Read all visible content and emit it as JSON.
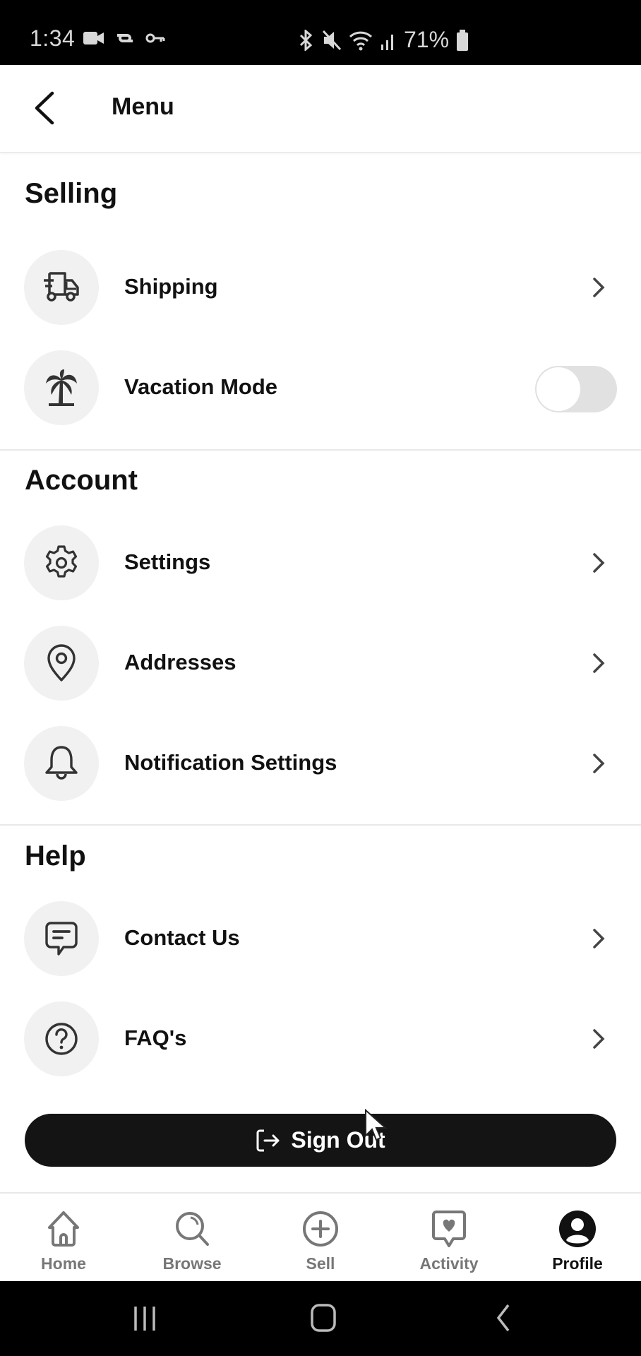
{
  "status_bar": {
    "time": "1:34",
    "left_icons": [
      "video-call-icon",
      "link-icon",
      "vpn-key-icon"
    ],
    "right_icons": [
      "bluetooth-icon",
      "mute-icon",
      "wifi-icon",
      "signal-icon"
    ],
    "battery": "71%"
  },
  "header": {
    "title": "Menu",
    "back_icon": "chevron-left-icon"
  },
  "sections": [
    {
      "title": "Selling",
      "items": [
        {
          "label": "Shipping",
          "icon": "truck-icon",
          "control": "chevron"
        },
        {
          "label": "Vacation Mode",
          "icon": "palm-tree-icon",
          "control": "toggle",
          "toggle_on": false
        }
      ]
    },
    {
      "title": "Account",
      "items": [
        {
          "label": "Settings",
          "icon": "gear-icon",
          "control": "chevron"
        },
        {
          "label": "Addresses",
          "icon": "location-pin-icon",
          "control": "chevron"
        },
        {
          "label": "Notification Settings",
          "icon": "bell-icon",
          "control": "chevron"
        }
      ]
    },
    {
      "title": "Help",
      "items": [
        {
          "label": "Contact Us",
          "icon": "chat-icon",
          "control": "chevron"
        },
        {
          "label": "FAQ's",
          "icon": "question-circle-icon",
          "control": "chevron"
        }
      ]
    }
  ],
  "sign_out": {
    "label": "Sign Out",
    "icon": "sign-out-icon"
  },
  "tabbar": {
    "tabs": [
      {
        "label": "Home",
        "icon": "home-icon",
        "active": false
      },
      {
        "label": "Browse",
        "icon": "search-icon",
        "active": false
      },
      {
        "label": "Sell",
        "icon": "plus-circle-icon",
        "active": false
      },
      {
        "label": "Activity",
        "icon": "heart-chat-icon",
        "active": false
      },
      {
        "label": "Profile",
        "icon": "profile-icon",
        "active": true
      }
    ]
  },
  "colors": {
    "primary": "#141414",
    "icon_bg": "#f1f1f1",
    "inactive": "#777777",
    "toggle_off": "#e1e1e1"
  }
}
